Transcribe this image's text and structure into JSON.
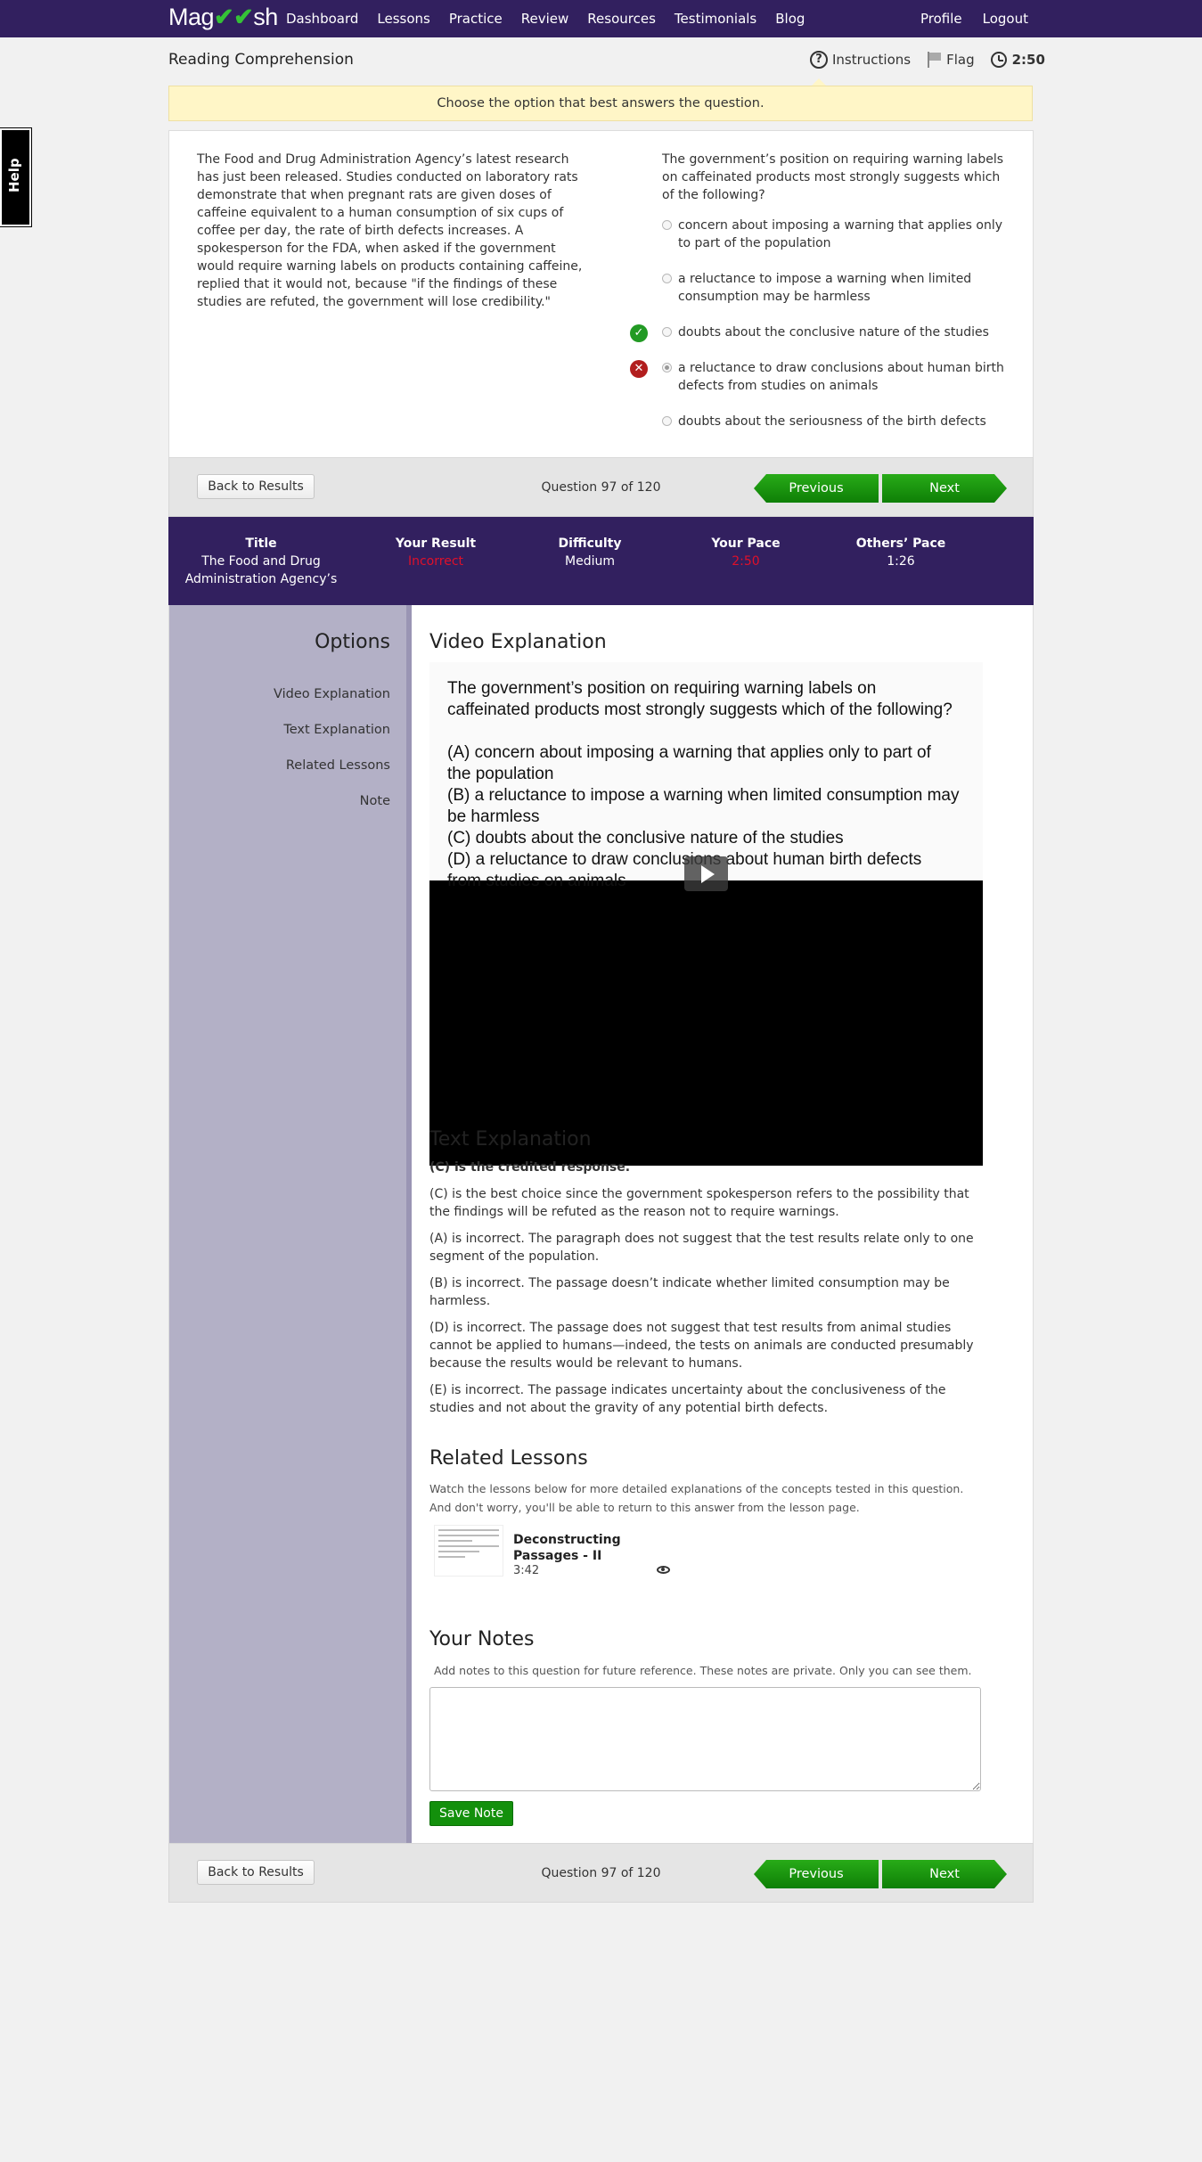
{
  "brand": {
    "logo_text_a": "Mag",
    "logo_check": "✔✔",
    "logo_text_b": "sh",
    "accent": "#32205f",
    "green": "#1a9a12"
  },
  "nav": {
    "links": [
      "Dashboard",
      "Lessons",
      "Practice",
      "Review",
      "Resources",
      "Testimonials",
      "Blog"
    ],
    "right": [
      "Profile",
      "Logout"
    ]
  },
  "help_tab": "Help",
  "header": {
    "title": "Reading Comprehension",
    "instructions": "Instructions",
    "flag": "Flag",
    "timer": "2:50"
  },
  "banner": "Choose the option that best answers the question.",
  "question": {
    "passage": "The Food and Drug Administration Agency’s latest research has just been released. Studies conducted on laboratory rats demonstrate that when pregnant rats are given doses of caffeine equivalent to a human consumption of six cups of coffee per day, the rate of birth defects increases. A spokesperson for the FDA, when asked if the government would require warning labels on products containing caffeine, replied that it would not, because \"if the findings of these studies are refuted, the government will lose credibility.\"",
    "stem": "The government’s position on requiring warning labels on caffeinated products most strongly suggests which of the following?",
    "choices": [
      {
        "text": "concern about imposing a warning that applies only to part of the population",
        "status": ""
      },
      {
        "text": "a reluctance to impose a warning when limited consumption may be harmless",
        "status": ""
      },
      {
        "text": "doubts about the conclusive nature of the studies",
        "status": "correct"
      },
      {
        "text": "a reluctance to draw conclusions about human birth defects from studies on animals",
        "status": "selected-wrong"
      },
      {
        "text": "doubts about the seriousness of the birth defects",
        "status": ""
      }
    ]
  },
  "navbar": {
    "back": "Back to Results",
    "count": "Question 97 of 120",
    "prev": "Previous",
    "next": "Next"
  },
  "stats": {
    "title_label": "Title",
    "title_value": "The Food and Drug Administration Agency’s",
    "result_label": "Your Result",
    "result_value": "Incorrect",
    "difficulty_label": "Difficulty",
    "difficulty_value": "Medium",
    "pace_label": "Your Pace",
    "pace_value": "2:50",
    "others_label": "Others’ Pace",
    "others_value": "1:26"
  },
  "options": {
    "title": "Options",
    "items": [
      "Video Explanation",
      "Text Explanation",
      "Related Lessons",
      "Note"
    ]
  },
  "video": {
    "heading": "Video Explanation",
    "lines_a": [
      "The government’s position on requiring warning labels on",
      "caffeinated products most strongly suggests which of the following?"
    ],
    "lines_b": [
      "(A) concern about imposing a warning that applies only to part of",
      "the population",
      "(B) a reluctance to impose a warning when limited consumption  may",
      "be harmless",
      "(C) doubts about the conclusive nature of the studies",
      "(D) a reluctance to draw conclusions about human birth defects",
      "from studies on animals"
    ]
  },
  "text_explanation": {
    "heading": "Text Explanation",
    "credited": "(C) is the credited response.",
    "paragraphs": [
      "(C) is the best choice since the government spokesperson refers to the possibility that the findings will be refuted as the reason not to require warnings.",
      "(A) is incorrect. The paragraph does not suggest that the test results relate only to one segment of the population.",
      "(B) is incorrect. The passage doesn’t indicate whether limited consumption may be harmless.",
      "(D) is incorrect. The passage does not suggest that test results from animal studies cannot be applied to humans—indeed, the tests on animals are conducted presumably because the results would be relevant to humans.",
      "(E) is incorrect. The passage indicates uncertainty about the conclusiveness of the studies and not about the gravity of any potential birth defects."
    ]
  },
  "related": {
    "heading": "Related Lessons",
    "sub": "Watch the lessons below for more detailed explanations of the concepts tested in this question. And don't worry, you'll be able to return to this answer from the lesson page.",
    "lesson_title": "Deconstructing Passages - II",
    "lesson_time": "3:42"
  },
  "notes": {
    "heading": "Your Notes",
    "sub": "Add notes to this question for future reference. These notes are private. Only you can see them.",
    "value": "",
    "save": "Save Note"
  }
}
